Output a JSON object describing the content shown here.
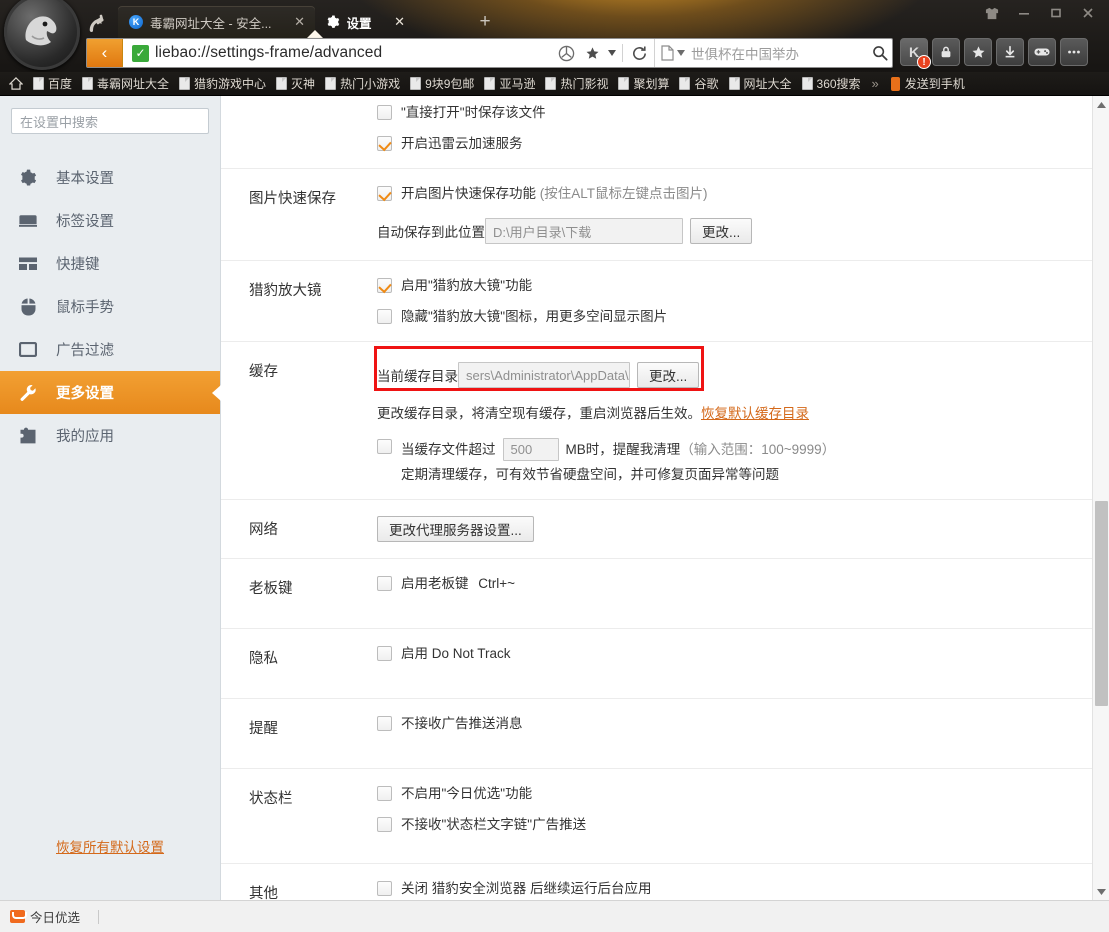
{
  "window": {
    "controls": [
      "shirt-icon",
      "minimize",
      "maximize",
      "close"
    ]
  },
  "tabs": [
    {
      "title": "毒霸网址大全 - 安全...",
      "favicon": "K",
      "active": false,
      "close": "✕"
    },
    {
      "title": "设置",
      "favicon": "gear-icon",
      "active": true,
      "close": "✕"
    }
  ],
  "newtab_label": "+",
  "address_bar": {
    "back_label": "‹",
    "secure_mark": "✓",
    "url": "liebao://settings-frame/advanced",
    "search_placeholder": "世俱杯在中国举办"
  },
  "toolbar_buttons": [
    {
      "name": "kingsoft-guard",
      "glyph": "K",
      "badge": "!"
    },
    {
      "name": "privacy-lock",
      "glyph": "lock"
    },
    {
      "name": "favorites-star",
      "glyph": "star"
    },
    {
      "name": "downloads",
      "glyph": "download"
    },
    {
      "name": "game-center",
      "glyph": "gamepad"
    },
    {
      "name": "more-menu",
      "glyph": "dots"
    }
  ],
  "bookmarks": {
    "home": "home-icon",
    "items": [
      "百度",
      "毒霸网址大全",
      "猎豹游戏中心",
      "灭神",
      "热门小游戏",
      "9块9包邮",
      "亚马逊",
      "热门影视",
      "聚划算",
      "谷歌",
      "网址大全",
      "360搜索"
    ],
    "overflow": "»",
    "send_to_phone": "发送到手机"
  },
  "sidebar": {
    "search_placeholder": "在设置中搜索",
    "items": [
      {
        "label": "基本设置",
        "icon": "gear-icon",
        "active": false
      },
      {
        "label": "标签设置",
        "icon": "tab-icon",
        "active": false
      },
      {
        "label": "快捷键",
        "icon": "keyboard-icon",
        "active": false
      },
      {
        "label": "鼠标手势",
        "icon": "mouse-icon",
        "active": false
      },
      {
        "label": "广告过滤",
        "icon": "window-icon",
        "active": false
      },
      {
        "label": "更多设置",
        "icon": "wrench-icon",
        "active": true
      },
      {
        "label": "我的应用",
        "icon": "puzzle-icon",
        "active": false
      }
    ],
    "restore_all": "恢复所有默认设置"
  },
  "settings": {
    "download_partial": {
      "options": [
        {
          "label": "\"直接打开\"时保存该文件",
          "checked": false
        },
        {
          "label": "开启迅雷云加速服务",
          "checked": true
        }
      ]
    },
    "image_quick_save": {
      "label": "图片快速保存",
      "option": {
        "label": "开启图片快速保存功能",
        "note": "(按住ALT鼠标左键点击图片)",
        "checked": true
      },
      "path_label": "自动保存到此位置",
      "path_value": "D:\\用户目录\\下载",
      "change_button": "更改..."
    },
    "magnifier": {
      "label": "猎豹放大镜",
      "options": [
        {
          "label": "启用\"猎豹放大镜\"功能",
          "checked": true
        },
        {
          "label": "隐藏\"猎豹放大镜\"图标，用更多空间显示图片",
          "checked": false
        }
      ]
    },
    "cache": {
      "label": "缓存",
      "dir_label": "当前缓存目录",
      "dir_value": "sers\\Administrator\\AppData\\",
      "change_button": "更改...",
      "hint_text": "更改缓存目录，将清空现有缓存，重启浏览器后生效。",
      "hint_link": "恢复默认缓存目录",
      "size_checked": false,
      "size_prefix": "当缓存文件超过",
      "size_value": "500",
      "size_suffix": "MB时，提醒我清理",
      "size_range": "（输入范围：100~9999）",
      "size_note": "定期清理缓存，可有效节省硬盘空间，并可修复页面异常等问题"
    },
    "network": {
      "label": "网络",
      "proxy_button": "更改代理服务器设置..."
    },
    "boss_key": {
      "label": "老板键",
      "option": {
        "label": "启用老板键",
        "shortcut": "Ctrl+~",
        "checked": false
      }
    },
    "privacy": {
      "label": "隐私",
      "option": {
        "label": "启用 Do Not Track",
        "checked": false
      }
    },
    "notice": {
      "label": "提醒",
      "option": {
        "label": "不接收广告推送消息",
        "checked": false
      }
    },
    "statusbar_section": {
      "label": "状态栏",
      "options": [
        {
          "label": "不启用\"今日优选\"功能",
          "checked": false
        },
        {
          "label": "不接收\"状态栏文字链\"广告推送",
          "checked": false
        }
      ]
    },
    "other": {
      "label": "其他",
      "option": {
        "label": "关闭 猎豹安全浏览器 后继续运行后台应用",
        "checked": false
      }
    }
  },
  "status_bar": {
    "today_pick": "今日优选"
  },
  "colors": {
    "accent_orange": "#e8891c",
    "highlight_red": "#ef1313",
    "link_orange": "#d4691a",
    "check_orange": "#ef8a14",
    "secure_green": "#3aa93a"
  }
}
